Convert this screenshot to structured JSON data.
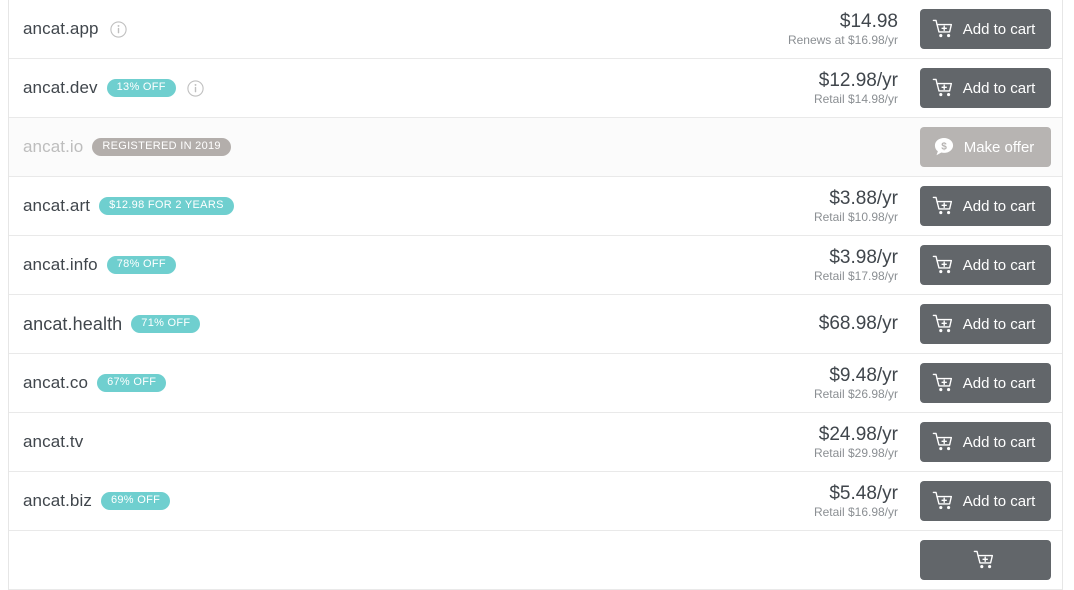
{
  "results": [
    {
      "domain": "ancat.app",
      "badge": null,
      "info_icon": "info-circle-icon",
      "price": "$14.98",
      "price_sub": "Renews at $16.98/yr",
      "action_label": "Add to cart",
      "action_icon": "add-to-cart-icon",
      "available": true
    },
    {
      "domain": "ancat.dev",
      "badge": "13% OFF",
      "info_icon": "info-circle-icon",
      "price": "$12.98/yr",
      "price_sub": "Retail $14.98/yr",
      "action_label": "Add to cart",
      "action_icon": "add-to-cart-icon",
      "available": true
    },
    {
      "domain": "ancat.io",
      "badge": "REGISTERED IN 2019",
      "info_icon": null,
      "price": "",
      "price_sub": "",
      "action_label": "Make offer",
      "action_icon": "offer-bubble-icon",
      "available": false
    },
    {
      "domain": "ancat.art",
      "badge": "$12.98 FOR 2 YEARS",
      "info_icon": null,
      "price": "$3.88/yr",
      "price_sub": "Retail $10.98/yr",
      "action_label": "Add to cart",
      "action_icon": "add-to-cart-icon",
      "available": true
    },
    {
      "domain": "ancat.info",
      "badge": "78% OFF",
      "info_icon": null,
      "price": "$3.98/yr",
      "price_sub": "Retail $17.98/yr",
      "action_label": "Add to cart",
      "action_icon": "add-to-cart-icon",
      "available": true
    },
    {
      "domain": "ancat.health",
      "badge": "71% OFF",
      "info_icon": null,
      "price": "$68.98/yr",
      "price_sub": "",
      "action_label": "Add to cart",
      "action_icon": "add-to-cart-icon",
      "available": true
    },
    {
      "domain": "ancat.co",
      "badge": "67% OFF",
      "info_icon": null,
      "price": "$9.48/yr",
      "price_sub": "Retail $26.98/yr",
      "action_label": "Add to cart",
      "action_icon": "add-to-cart-icon",
      "available": true
    },
    {
      "domain": "ancat.tv",
      "badge": null,
      "info_icon": null,
      "price": "$24.98/yr",
      "price_sub": "Retail $29.98/yr",
      "action_label": "Add to cart",
      "action_icon": "add-to-cart-icon",
      "available": true
    },
    {
      "domain": "ancat.biz",
      "badge": "69% OFF",
      "info_icon": null,
      "price": "$5.48/yr",
      "price_sub": "Retail $16.98/yr",
      "action_label": "Add to cart",
      "action_icon": "add-to-cart-icon",
      "available": true
    },
    {
      "domain": "",
      "badge": null,
      "info_icon": null,
      "price": "",
      "price_sub": "",
      "action_label": "",
      "action_icon": "add-to-cart-icon",
      "available": true
    }
  ],
  "colors": {
    "badge_promo": "#6fcfcf",
    "badge_registered": "#b3aeab",
    "button_primary": "#62666a",
    "button_offer": "#b7b4b2",
    "domain_text": "#40464c",
    "domain_text_muted": "#bdbdbd",
    "price_sub_text": "#8b8f93",
    "row_divider": "#e9e9e9"
  }
}
